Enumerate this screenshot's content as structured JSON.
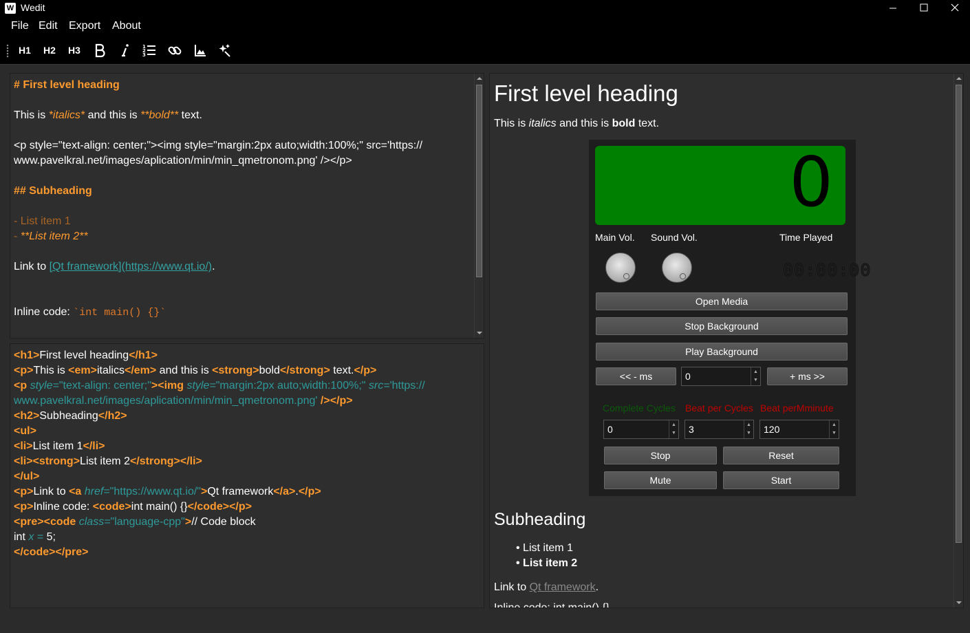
{
  "window": {
    "title": "Wedit",
    "icon_letter": "W"
  },
  "menu": [
    "File",
    "Edit",
    "Export",
    "About"
  ],
  "toolbar": {
    "h1": "H1",
    "h2": "H2",
    "h3": "H3",
    "icons": [
      "bold-icon",
      "italic-icon",
      "numbered-list-icon",
      "link-icon",
      "image-icon",
      "magic-icon"
    ]
  },
  "markdown": {
    "l1": "# First level heading",
    "l2a": "This is ",
    "l2b": "*italics*",
    "l2c": " and this is ",
    "l2d": "**bold**",
    "l2e": " text.",
    "l3": "<p style=\"text-align: center;\"><img style=\"margin:2px auto;width:100%;\" src='https://",
    "l4": "www.pavelkral.net/images/aplication/min/min_qmetronom.png' /></p>",
    "l5": "## Subheading",
    "l6": "- List item 1",
    "l7a": "- ",
    "l7b": "**List item 2**",
    "l8a": "Link to ",
    "l8b": "[Qt framework](https://www.qt.io/)",
    "l8c": ".",
    "l9a": "Inline code: ",
    "l9b": "`int main() {}`"
  },
  "html_source": {
    "h1_open": "<h1>",
    "h1_text": "First level heading",
    "h1_close": "</h1>",
    "p_open": "<p>",
    "p1a": "This is ",
    "em_open": "<em>",
    "em_text": "italics",
    "em_close": "</em>",
    "p1b": " and this is ",
    "strong_open": "<strong>",
    "strong_text": "bold",
    "strong_close": "</strong>",
    "p1c": " text.",
    "p_close": "</p>",
    "img_p_open": "<p ",
    "style_attr": "style=",
    "style_val": "\"text-align: center;\"",
    "gt": ">",
    "img_open": "<img ",
    "img_style_val": "\"margin:2px auto;width:100%;\"",
    "src_attr": "src=",
    "src_val_a": "'https://",
    "src_val_b": "www.pavelkral.net/images/aplication/min/min_qmetronom.png'",
    "img_close": " /></p>",
    "h2_open": "<h2>",
    "h2_text": "Subheading",
    "h2_close": "</h2>",
    "ul_open": "<ul>",
    "li_open": "<li>",
    "li1_text": "List item 1",
    "li_close": "</li>",
    "li2_strong_text": "List item 2",
    "ul_close": "</ul>",
    "link_text": "Link to ",
    "a_open": "<a ",
    "href_attr": "href=",
    "href_val": "\"https://www.qt.io/\"",
    "a_text": "Qt framework",
    "a_close": "</a>",
    "dot": ".",
    "code_label": "Inline code: ",
    "code_open": "<code>",
    "code_text": "int main() {}",
    "code_close": "</code>",
    "pre_open": "<pre>",
    "code_class_open": "<code ",
    "class_attr": "class=",
    "class_val": "\"language-cpp\"",
    "comment": "// Code block",
    "int_text": "int ",
    "x_var": "x",
    "eq": " = ",
    "five": "5;",
    "pre_close": "</code></pre>"
  },
  "preview": {
    "h1": "First level heading",
    "para_a": "This is ",
    "para_em": "italics",
    "para_b": " and this is ",
    "para_strong": "bold",
    "para_c": " text.",
    "h2": "Subheading",
    "li1": "List item 1",
    "li2": "List item 2",
    "link_prefix": "Link to ",
    "link_text": "Qt framework",
    "link_suffix": ".",
    "inline_partial": "Inline code: int main() {}"
  },
  "metronome": {
    "display_value": "0",
    "main_vol_label": "Main Vol.",
    "sound_vol_label": "Sound Vol.",
    "time_played_label": "Time Played",
    "time_played": "00:00:00",
    "open_media": "Open Media",
    "stop_background": "Stop Background",
    "play_background": "Play Background",
    "minus_ms": "<< -  ms",
    "ms_value": "0",
    "plus_ms": "+ ms >>",
    "complete_cycles_label": "Complete Cycles",
    "beat_per_cycles_label": "Beat per Cycles",
    "beat_per_minute_label": "Beat perMminute",
    "complete_cycles": "0",
    "beat_per_cycles": "3",
    "beat_per_minute": "120",
    "stop": "Stop",
    "reset": "Reset",
    "mute": "Mute",
    "start": "Start",
    "colors": {
      "display": "#008000",
      "complete_cycles": "#0a5a0a",
      "beat": "#c00000"
    }
  }
}
